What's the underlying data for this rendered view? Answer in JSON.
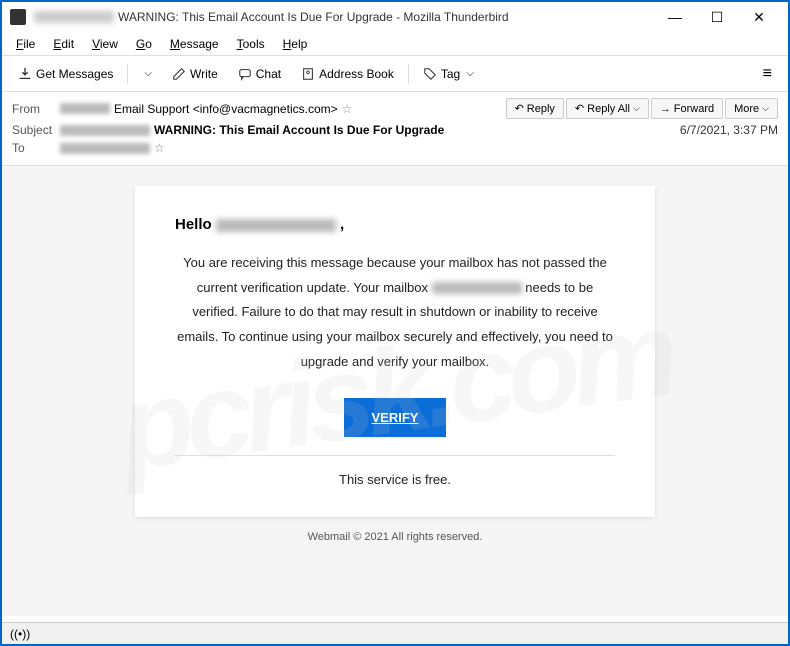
{
  "window": {
    "title_suffix": "WARNING: This Email Account Is Due For Upgrade - Mozilla Thunderbird",
    "minimize": "—",
    "maximize": "☐",
    "close": "✕"
  },
  "menu": {
    "file": "File",
    "edit": "Edit",
    "view": "View",
    "go": "Go",
    "message": "Message",
    "tools": "Tools",
    "help": "Help"
  },
  "toolbar": {
    "get_messages": "Get Messages",
    "write": "Write",
    "chat": "Chat",
    "address_book": "Address Book",
    "tag": "Tag"
  },
  "headers": {
    "from_label": "From",
    "from_value": "Email Support <info@vacmagnetics.com>",
    "subject_label": "Subject",
    "subject_value": "WARNING: This Email Account Is Due For Upgrade",
    "to_label": "To",
    "date": "6/7/2021, 3:37 PM"
  },
  "actions": {
    "reply": "Reply",
    "reply_all": "Reply All",
    "forward": "Forward",
    "more": "More"
  },
  "body": {
    "hello": "Hello",
    "p1": "You are receiving this message because your mailbox has not passed the current verification update. Your mailbox",
    "p2": "needs to be verified. Failure to do that may result in shutdown or inability to receive emails. To continue using your mailbox securely and effectively, you need to upgrade and verify your mailbox.",
    "verify": "VERIFY",
    "free": "This service is free.",
    "footer": "Webmail © 2021 All rights reserved."
  }
}
